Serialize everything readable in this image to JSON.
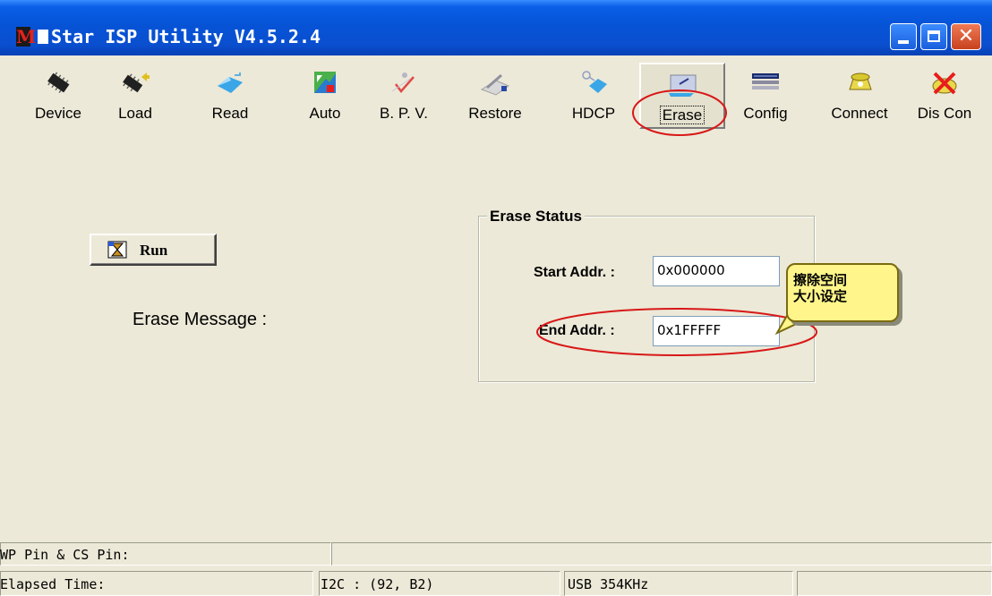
{
  "window": {
    "title": "Star ISP Utility V4.5.2.4",
    "icon_letter": "M",
    "minimize_icon": "minimize-icon",
    "maximize_icon": "maximize-icon",
    "close_glyph": "✕"
  },
  "toolbar": [
    {
      "label": "Device",
      "icon": "chip-icon"
    },
    {
      "label": "Load",
      "icon": "chip-load-icon"
    },
    {
      "label": "Read",
      "icon": "diamond-read-icon"
    },
    {
      "label": "Auto",
      "icon": "auto-icon"
    },
    {
      "label": "B. P. V.",
      "icon": "check-icon"
    },
    {
      "label": "Restore",
      "icon": "restore-icon"
    },
    {
      "label": "HDCP",
      "icon": "hdcp-icon"
    },
    {
      "label": "Erase",
      "icon": "erase-icon"
    },
    {
      "label": "Config",
      "icon": "config-icon"
    },
    {
      "label": "Connect",
      "icon": "phone-icon"
    },
    {
      "label": "Dis Con",
      "icon": "disconnect-icon"
    }
  ],
  "run_button": {
    "label": "Run",
    "icon": "hourglass-icon"
  },
  "erase_message_label": "Erase Message :",
  "erase_status": {
    "title": "Erase Status",
    "start_label": "Start Addr. :",
    "start_value": "0x000000",
    "end_label": "End Addr. :",
    "end_value": "0x1FFFFF"
  },
  "callout": {
    "line1": "擦除空间",
    "line2": "大小设定"
  },
  "status": {
    "wp_pin": "WP Pin & CS Pin:",
    "elapsed": "Elapsed Time:",
    "i2c": "I2C :  (92, B2)",
    "usb": "USB  354KHz"
  },
  "colors": {
    "annotation_red": "#d81818",
    "callout_yellow": "#fff58a",
    "titlebar_blue": "#0653d6"
  }
}
